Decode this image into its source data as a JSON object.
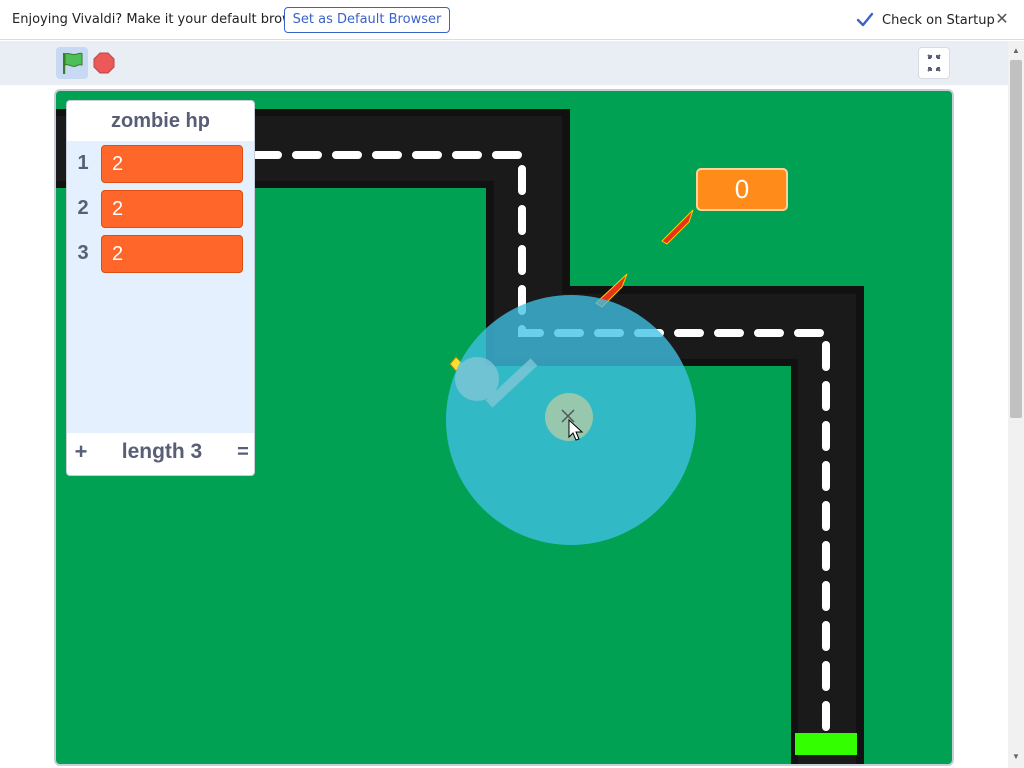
{
  "notification": {
    "message": "Enjoying Vivaldi? Make it your default browser.",
    "default_button": "Set as Default Browser",
    "startup_checkbox_label": "Check on Startup",
    "startup_checked": true,
    "close_icon": "close-icon"
  },
  "toolbar": {
    "green_flag_icon": "green-flag-icon",
    "stop_icon": "stop-icon",
    "fullscreen_icon": "exit-fullscreen-icon"
  },
  "list_monitor": {
    "title": "zombie hp",
    "items": [
      {
        "index": "1",
        "value": "2"
      },
      {
        "index": "2",
        "value": "2"
      },
      {
        "index": "3",
        "value": "2"
      }
    ],
    "add_label": "+",
    "length_label": "length 3",
    "resize_label": "="
  },
  "score_monitor": {
    "value": "0"
  },
  "colors": {
    "grass": "#00a152",
    "road": "#111111",
    "list_cell": "#ff6629",
    "score_bg": "#ff8c1a",
    "range_circle": "#3fc1e6",
    "goal": "#33ff00"
  }
}
